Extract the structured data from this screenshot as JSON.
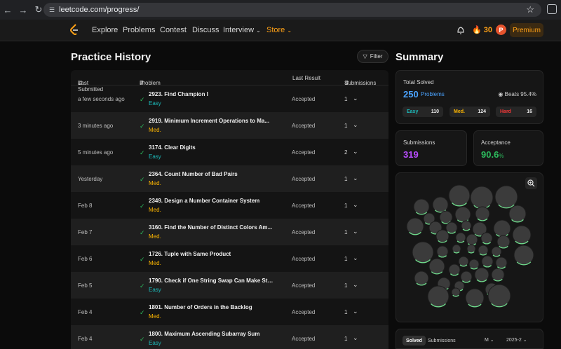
{
  "browser": {
    "url": "leetcode.com/progress/"
  },
  "nav": {
    "items": [
      "Explore",
      "Problems",
      "Contest",
      "Discuss",
      "Interview",
      "Store"
    ],
    "streak": "30",
    "avatar_initial": "P",
    "premium_label": "Premium"
  },
  "history": {
    "title": "Practice History",
    "filter_label": "Filter",
    "columns": [
      "Last Submitted",
      "Problem",
      "Last Result",
      "Submissions"
    ],
    "rows": [
      {
        "date": "a few seconds ago",
        "title": "2923. Find Champion I",
        "difficulty": "Easy",
        "result": "Accepted",
        "submissions": "1"
      },
      {
        "date": "3 minutes ago",
        "title": "2919. Minimum Increment Operations to Ma...",
        "difficulty": "Med.",
        "result": "Accepted",
        "submissions": "1"
      },
      {
        "date": "5 minutes ago",
        "title": "3174. Clear Digits",
        "difficulty": "Easy",
        "result": "Accepted",
        "submissions": "2"
      },
      {
        "date": "Yesterday",
        "title": "2364. Count Number of Bad Pairs",
        "difficulty": "Med.",
        "result": "Accepted",
        "submissions": "1"
      },
      {
        "date": "Feb 8",
        "title": "2349. Design a Number Container System",
        "difficulty": "Med.",
        "result": "Accepted",
        "submissions": "1"
      },
      {
        "date": "Feb 7",
        "title": "3160. Find the Number of Distinct Colors Am...",
        "difficulty": "Med.",
        "result": "Accepted",
        "submissions": "1"
      },
      {
        "date": "Feb 6",
        "title": "1726. Tuple with Same Product",
        "difficulty": "Med.",
        "result": "Accepted",
        "submissions": "1"
      },
      {
        "date": "Feb 5",
        "title": "1790. Check if One String Swap Can Make Stri...",
        "difficulty": "Easy",
        "result": "Accepted",
        "submissions": "1"
      },
      {
        "date": "Feb 4",
        "title": "1801. Number of Orders in the Backlog",
        "difficulty": "Med.",
        "result": "Accepted",
        "submissions": "1"
      },
      {
        "date": "Feb 4",
        "title": "1800. Maximum Ascending Subarray Sum",
        "difficulty": "Easy",
        "result": "Accepted",
        "submissions": "1"
      }
    ]
  },
  "summary": {
    "title": "Summary",
    "total_solved_label": "Total Solved",
    "total_solved": "250",
    "problems_label": "Problems",
    "beats": "Beats 95.4%",
    "easy_label": "Easy",
    "easy_count": "110",
    "med_label": "Med.",
    "med_count": "124",
    "hard_label": "Hard",
    "hard_count": "16",
    "submissions_label": "Submissions",
    "submissions_value": "319",
    "acceptance_label": "Acceptance",
    "acceptance_value": "90.6",
    "acceptance_unit": "%",
    "tab_solved": "Solved",
    "tab_submissions": "Submissions",
    "select_m": "M",
    "select_period": "2025-2"
  },
  "colors": {
    "easy": "#1cbaba",
    "medium": "#ffb700",
    "hard": "#f63737",
    "accent": "#ffa116",
    "check": "#2cbb5d"
  }
}
